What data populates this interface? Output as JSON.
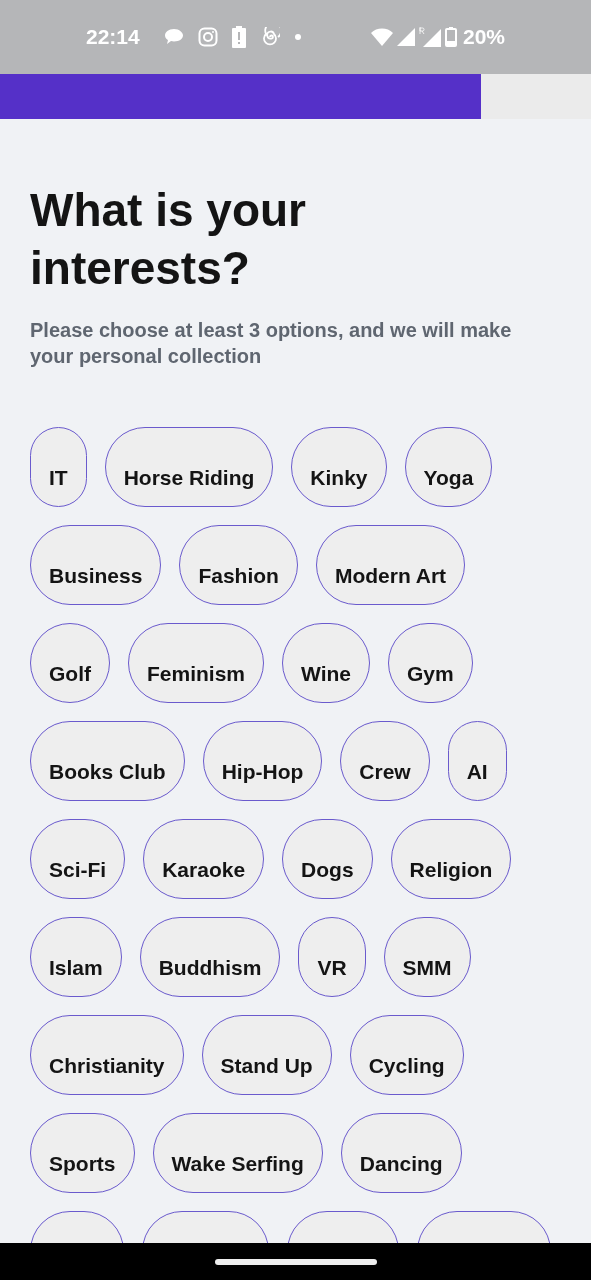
{
  "status_bar": {
    "time": "22:14",
    "battery": "20%"
  },
  "progress": {
    "level": 0.814
  },
  "title": "What is your interests?",
  "subtitle": "Please choose at least 3 options, and we will make your personal collection",
  "chip_rows": [
    {
      "chips": [
        {
          "label": "IT",
          "selected": false
        },
        {
          "label": "Horse Riding",
          "selected": false
        },
        {
          "label": "Kinky",
          "selected": false
        },
        {
          "label": "Yoga",
          "selected": false
        }
      ]
    },
    {
      "chips": [
        {
          "label": "Business",
          "selected": false
        },
        {
          "label": "Fashion",
          "selected": false
        },
        {
          "label": "Modern Art",
          "selected": false
        }
      ]
    },
    {
      "chips": [
        {
          "label": "Golf",
          "selected": false
        },
        {
          "label": "Feminism",
          "selected": false
        },
        {
          "label": "Wine",
          "selected": false
        },
        {
          "label": "Gym",
          "selected": false
        }
      ]
    },
    {
      "chips": [
        {
          "label": "Books Club",
          "selected": false
        },
        {
          "label": "Hip-Hop",
          "selected": false
        },
        {
          "label": "Crew",
          "selected": false
        },
        {
          "label": "AI",
          "selected": false
        }
      ]
    },
    {
      "chips": [
        {
          "label": "Sci-Fi",
          "selected": false
        },
        {
          "label": "Karaoke",
          "selected": false
        },
        {
          "label": "Dogs",
          "selected": false
        },
        {
          "label": "Religion",
          "selected": false
        }
      ]
    },
    {
      "chips": [
        {
          "label": "Islam",
          "selected": false
        },
        {
          "label": "Buddhism",
          "selected": false
        },
        {
          "label": "VR",
          "selected": false
        },
        {
          "label": "SMM",
          "selected": false
        }
      ]
    },
    {
      "chips": [
        {
          "label": "Christianity",
          "selected": false
        },
        {
          "label": "Stand Up",
          "selected": false
        },
        {
          "label": "Cycling",
          "selected": false
        }
      ]
    },
    {
      "chips": [
        {
          "label": "Sports",
          "selected": false
        },
        {
          "label": "Wake Serfing",
          "selected": false
        },
        {
          "label": "Dancing",
          "selected": false
        }
      ]
    }
  ],
  "cut_row": [
    {
      "kind": "chip"
    },
    {
      "kind": "chip"
    },
    {
      "kind": "chip"
    },
    {
      "kind": "chip"
    }
  ]
}
